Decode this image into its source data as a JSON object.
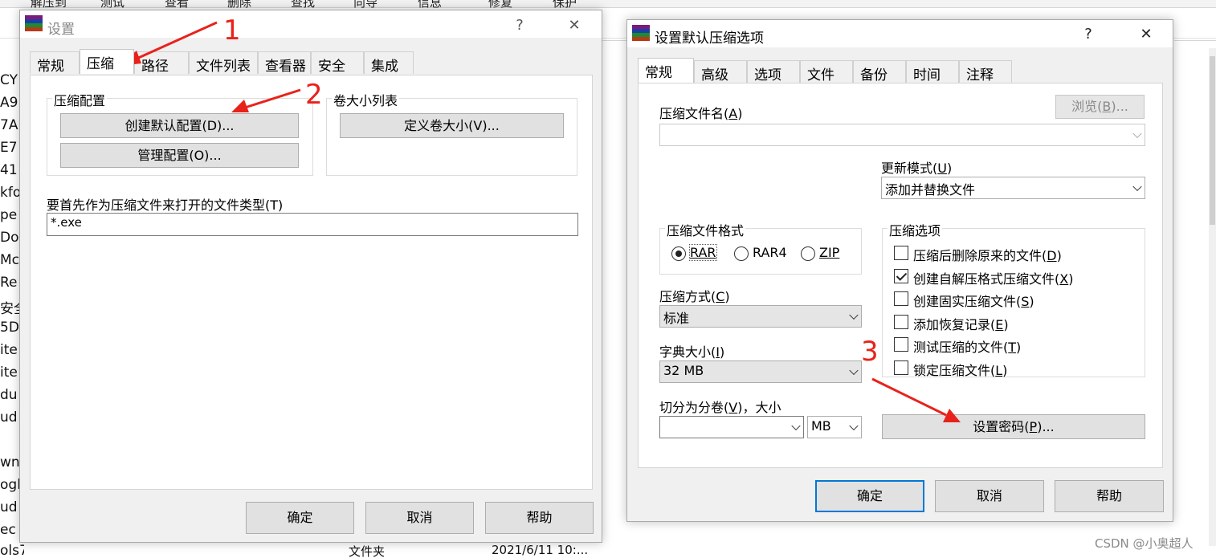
{
  "background": {
    "toolbar": [
      "解压到",
      "测试",
      "查看",
      "删除",
      "查找",
      "向导",
      "信息",
      "修复",
      "保护"
    ],
    "left_items": [
      "CY",
      "A9",
      "7A",
      "E7",
      "41",
      "kfo",
      "pe",
      "Do",
      "Mc",
      "Re",
      "安全",
      "5D",
      "ite",
      "ite",
      "du",
      "ud",
      "",
      "wn",
      "ogl",
      "ud",
      "ec",
      "ols7"
    ],
    "bottom_row": {
      "type": "文件夹",
      "date": "2021/6/11 10:..."
    }
  },
  "settings_dialog": {
    "title": "设置",
    "help_btn": "?",
    "close_btn": "✕",
    "tabs": [
      "常规",
      "压缩",
      "路径",
      "文件列表",
      "查看器",
      "安全",
      "集成"
    ],
    "active_tab": 1,
    "compress_profiles": {
      "label": "压缩配置",
      "create_default": "创建默认配置(D)...",
      "manage": "管理配置(O)..."
    },
    "volume_sizes": {
      "label": "卷大小列表",
      "define": "定义卷大小(V)..."
    },
    "open_as_archive": {
      "label": "要首先作为压缩文件来打开的文件类型(T)",
      "value": "*.exe"
    },
    "buttons": {
      "ok": "确定",
      "cancel": "取消",
      "help": "帮助"
    }
  },
  "default_dialog": {
    "title": "设置默认压缩选项",
    "help_btn": "?",
    "close_btn": "✕",
    "tabs": [
      "常规",
      "高级",
      "选项",
      "文件",
      "备份",
      "时间",
      "注释"
    ],
    "active_tab": 0,
    "archive_name": {
      "label_pre": "压缩文件名(",
      "label_key": "A",
      "label_post": ")",
      "value": ""
    },
    "browse": {
      "pre": "浏览(",
      "key": "B",
      "post": ")..."
    },
    "update_mode": {
      "label_pre": "更新模式(",
      "label_key": "U",
      "label_post": ")",
      "value": "添加并替换文件"
    },
    "archive_format": {
      "label": "压缩文件格式",
      "options": [
        {
          "label": "RAR",
          "selected": true
        },
        {
          "label": "RAR4",
          "selected": false
        },
        {
          "label": "ZIP",
          "selected": false
        }
      ]
    },
    "method": {
      "label_pre": "压缩方式(",
      "label_key": "C",
      "label_post": ")",
      "value": "标准"
    },
    "dictionary": {
      "label_pre": "字典大小(",
      "label_key": "I",
      "label_post": ")",
      "value": "32 MB"
    },
    "split": {
      "label_pre": "切分为分卷(",
      "label_key": "V",
      "label_post": ")，大小",
      "value": "",
      "unit": "MB"
    },
    "options": {
      "label": "压缩选项",
      "items": [
        {
          "pre": "压缩后删除原来的文件(",
          "key": "D",
          "post": ")",
          "checked": false
        },
        {
          "pre": "创建自解压格式压缩文件(",
          "key": "X",
          "post": ")",
          "checked": true
        },
        {
          "pre": "创建固实压缩文件(",
          "key": "S",
          "post": ")",
          "checked": false
        },
        {
          "pre": "添加恢复记录(",
          "key": "E",
          "post": ")",
          "checked": false
        },
        {
          "pre": "测试压缩的文件(",
          "key": "T",
          "post": ")",
          "checked": false
        },
        {
          "pre": "锁定压缩文件(",
          "key": "L",
          "post": ")",
          "checked": false
        }
      ]
    },
    "set_password": {
      "pre": "设置密码(",
      "key": "P",
      "post": ")..."
    },
    "buttons": {
      "ok": "确定",
      "cancel": "取消",
      "help": "帮助"
    }
  },
  "annotations": [
    "1",
    "2",
    "3"
  ],
  "annotation_color": "#e8221b",
  "watermark": "CSDN @小奥超人"
}
